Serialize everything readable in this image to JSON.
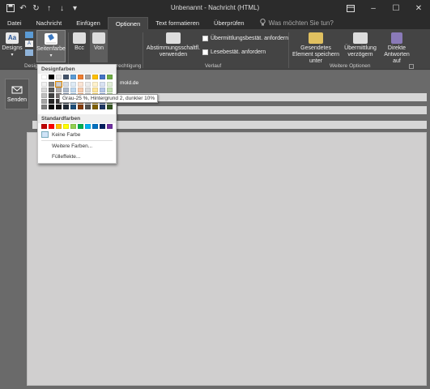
{
  "window": {
    "title": "Unbenannt - Nachricht (HTML)",
    "qat_icons": [
      "save-icon",
      "undo-icon",
      "redo-icon",
      "up-arrow-icon",
      "down-arrow-icon",
      "customize-icon"
    ],
    "controls": [
      "ribbon-options-icon",
      "minimize-icon",
      "maximize-icon",
      "close-icon"
    ]
  },
  "tabs": [
    {
      "label": "Datei",
      "active": false
    },
    {
      "label": "Nachricht",
      "active": false
    },
    {
      "label": "Einfügen",
      "active": false
    },
    {
      "label": "Optionen",
      "active": true
    },
    {
      "label": "Text formatieren",
      "active": false
    },
    {
      "label": "Überprüfen",
      "active": false
    }
  ],
  "tellme": "Was möchten Sie tun?",
  "ribbon": {
    "designs": "Designs",
    "seitenfarbe": "Seitenfarbe",
    "bcc": "Bcc",
    "von": "Von",
    "group_designs": "Desig",
    "group_fields": "rechtigung",
    "abstimmung": "Abstimmungsschaltfl. verwenden",
    "uebermittlung_anfordern": "Übermittlungsbestät. anfordern",
    "lesebestaet_anfordern": "Lesebestät. anfordern",
    "group_verlauf": "Verlauf",
    "gesendetes": "Gesendetes Element speichern unter",
    "uebermittlung_verzoegern": "Übermittlung verzögern",
    "direkte_antworten": "Direkte Antworten auf",
    "group_weitere": "Weitere Optionen"
  },
  "compose": {
    "send": "Senden",
    "from_value": "mold.de"
  },
  "picker": {
    "design_header": "Designfarben",
    "standard_header": "Standardfarben",
    "keine_farbe": "Keine Farbe",
    "weitere_farben": "Weitere Farben...",
    "fuelleffekte": "Fülleffekte...",
    "tooltip": "Grau-25 %, Hintergrund 2, dunkler 10%",
    "theme_top_row": [
      "#ffffff",
      "#000000",
      "#e7e6e6",
      "#44546a",
      "#5b9bd5",
      "#ed7d31",
      "#a5a5a5",
      "#ffc000",
      "#4472c4",
      "#70ad47"
    ],
    "theme_rows": [
      [
        "#f2f2f2",
        "#7f7f7f",
        "#d0cece",
        "#d6dce4",
        "#deebf6",
        "#fbe5d5",
        "#ededed",
        "#fff2cc",
        "#d9e2f3",
        "#e2efd9"
      ],
      [
        "#d9d9d9",
        "#595959",
        "#aeabab",
        "#adb9ca",
        "#bdd7ee",
        "#f7cbac",
        "#dbdbdb",
        "#fee599",
        "#b4c6e7",
        "#c5e0b3"
      ],
      [
        "#bfbfbf",
        "#404040",
        "#757070",
        "#8496b0",
        "#9dc3e6",
        "#f4b183",
        "#c9c9c9",
        "#ffd965",
        "#8eaadb",
        "#a8d08d"
      ],
      [
        "#a6a6a6",
        "#262626",
        "#3a3838",
        "#323f4f",
        "#2e75b5",
        "#c55a11",
        "#7b7b7b",
        "#bf9000",
        "#2f5496",
        "#538135"
      ],
      [
        "#7f7f7f",
        "#0d0d0d",
        "#171616",
        "#222a35",
        "#1e4e79",
        "#833c0b",
        "#525252",
        "#7f6000",
        "#1f3864",
        "#375623"
      ]
    ],
    "standard_colors": [
      "#c00000",
      "#ff0000",
      "#ffc000",
      "#ffff00",
      "#92d050",
      "#00b050",
      "#00b0f0",
      "#0070c0",
      "#002060",
      "#7030a0"
    ]
  }
}
